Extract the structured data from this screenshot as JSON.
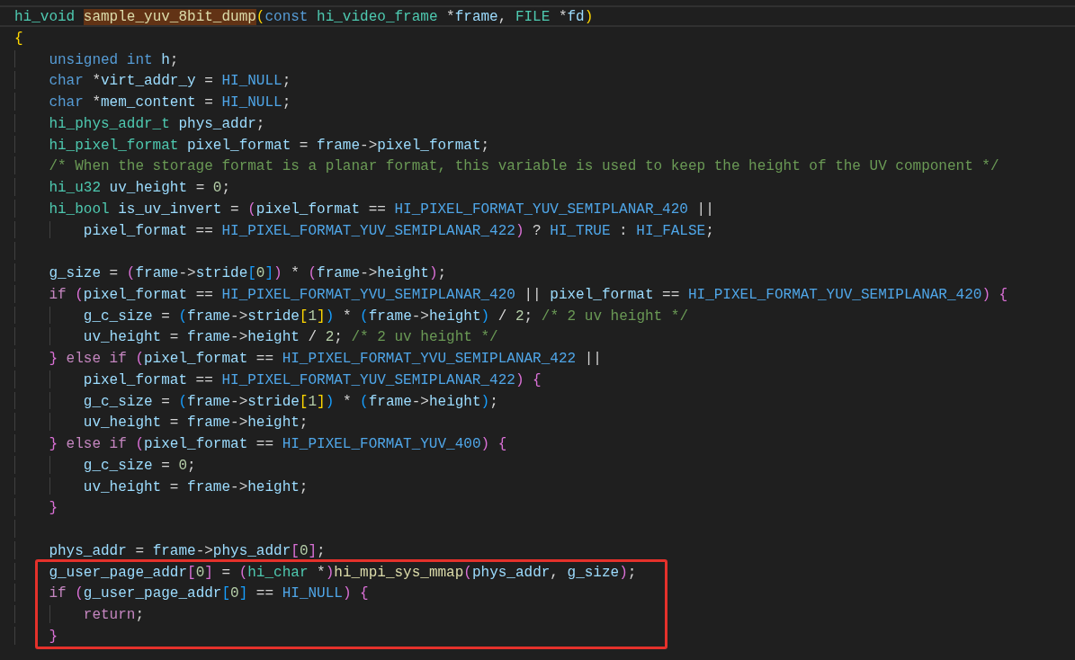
{
  "editor": {
    "lines": [
      {
        "kind": "code",
        "current": true,
        "boxed": false,
        "tokens": [
          {
            "kind": "type",
            "text": "hi_void "
          },
          {
            "kind": "fnmatch",
            "text": "sample_yuv_8bit_dump"
          },
          {
            "kind": "b1",
            "text": "("
          },
          {
            "kind": "kw",
            "text": "const "
          },
          {
            "kind": "type",
            "text": "hi_video_frame"
          },
          {
            "kind": "plain",
            "text": " *"
          },
          {
            "kind": "var",
            "text": "frame"
          },
          {
            "kind": "plain",
            "text": ", "
          },
          {
            "kind": "type",
            "text": "FILE"
          },
          {
            "kind": "plain",
            "text": " *"
          },
          {
            "kind": "var",
            "text": "fd"
          },
          {
            "kind": "b1",
            "text": ")"
          }
        ]
      },
      {
        "kind": "code",
        "current": false,
        "boxed": false,
        "tokens": [
          {
            "kind": "b1",
            "text": "{"
          }
        ]
      },
      {
        "kind": "code",
        "current": false,
        "boxed": false,
        "tokens": [
          {
            "kind": "kw",
            "text": "    unsigned int "
          },
          {
            "kind": "var",
            "text": "h"
          },
          {
            "kind": "plain",
            "text": ";"
          }
        ]
      },
      {
        "kind": "code",
        "current": false,
        "boxed": false,
        "tokens": [
          {
            "kind": "kw",
            "text": "    char"
          },
          {
            "kind": "plain",
            "text": " *"
          },
          {
            "kind": "var",
            "text": "virt_addr_y"
          },
          {
            "kind": "plain",
            "text": " = "
          },
          {
            "kind": "const",
            "text": "HI_NULL"
          },
          {
            "kind": "plain",
            "text": ";"
          }
        ]
      },
      {
        "kind": "code",
        "current": false,
        "boxed": false,
        "tokens": [
          {
            "kind": "kw",
            "text": "    char"
          },
          {
            "kind": "plain",
            "text": " *"
          },
          {
            "kind": "var",
            "text": "mem_content"
          },
          {
            "kind": "plain",
            "text": " = "
          },
          {
            "kind": "const",
            "text": "HI_NULL"
          },
          {
            "kind": "plain",
            "text": ";"
          }
        ]
      },
      {
        "kind": "code",
        "current": false,
        "boxed": false,
        "tokens": [
          {
            "kind": "type",
            "text": "    hi_phys_addr_t "
          },
          {
            "kind": "var",
            "text": "phys_addr"
          },
          {
            "kind": "plain",
            "text": ";"
          }
        ]
      },
      {
        "kind": "code",
        "current": false,
        "boxed": false,
        "tokens": [
          {
            "kind": "type",
            "text": "    hi_pixel_format "
          },
          {
            "kind": "var",
            "text": "pixel_format"
          },
          {
            "kind": "plain",
            "text": " = "
          },
          {
            "kind": "var",
            "text": "frame"
          },
          {
            "kind": "plain",
            "text": "->"
          },
          {
            "kind": "var",
            "text": "pixel_format"
          },
          {
            "kind": "plain",
            "text": ";"
          }
        ]
      },
      {
        "kind": "code",
        "current": false,
        "boxed": false,
        "tokens": [
          {
            "kind": "comment",
            "text": "    /* When the storage format is a planar format, this variable is used to keep the height of the UV component */"
          }
        ]
      },
      {
        "kind": "code",
        "current": false,
        "boxed": false,
        "tokens": [
          {
            "kind": "type",
            "text": "    hi_u32 "
          },
          {
            "kind": "var",
            "text": "uv_height"
          },
          {
            "kind": "plain",
            "text": " = "
          },
          {
            "kind": "num",
            "text": "0"
          },
          {
            "kind": "plain",
            "text": ";"
          }
        ]
      },
      {
        "kind": "code",
        "current": false,
        "boxed": false,
        "tokens": [
          {
            "kind": "type",
            "text": "    hi_bool "
          },
          {
            "kind": "var",
            "text": "is_uv_invert"
          },
          {
            "kind": "plain",
            "text": " = "
          },
          {
            "kind": "b2",
            "text": "("
          },
          {
            "kind": "var",
            "text": "pixel_format"
          },
          {
            "kind": "plain",
            "text": " == "
          },
          {
            "kind": "const",
            "text": "HI_PIXEL_FORMAT_YUV_SEMIPLANAR_420"
          },
          {
            "kind": "plain",
            "text": " ||"
          }
        ]
      },
      {
        "kind": "code",
        "current": false,
        "boxed": false,
        "tokens": [
          {
            "kind": "var",
            "text": "        pixel_format"
          },
          {
            "kind": "plain",
            "text": " == "
          },
          {
            "kind": "const",
            "text": "HI_PIXEL_FORMAT_YUV_SEMIPLANAR_422"
          },
          {
            "kind": "b2",
            "text": ")"
          },
          {
            "kind": "plain",
            "text": " ? "
          },
          {
            "kind": "const",
            "text": "HI_TRUE"
          },
          {
            "kind": "plain",
            "text": " : "
          },
          {
            "kind": "const",
            "text": "HI_FALSE"
          },
          {
            "kind": "plain",
            "text": ";"
          }
        ]
      },
      {
        "kind": "blank",
        "current": false,
        "boxed": false
      },
      {
        "kind": "code",
        "current": false,
        "boxed": false,
        "tokens": [
          {
            "kind": "var",
            "text": "    g_size"
          },
          {
            "kind": "plain",
            "text": " = "
          },
          {
            "kind": "b2",
            "text": "("
          },
          {
            "kind": "var",
            "text": "frame"
          },
          {
            "kind": "plain",
            "text": "->"
          },
          {
            "kind": "var",
            "text": "stride"
          },
          {
            "kind": "b3",
            "text": "["
          },
          {
            "kind": "num",
            "text": "0"
          },
          {
            "kind": "b3",
            "text": "]"
          },
          {
            "kind": "b2",
            "text": ")"
          },
          {
            "kind": "plain",
            "text": " * "
          },
          {
            "kind": "b2",
            "text": "("
          },
          {
            "kind": "var",
            "text": "frame"
          },
          {
            "kind": "plain",
            "text": "->"
          },
          {
            "kind": "var",
            "text": "height"
          },
          {
            "kind": "b2",
            "text": ")"
          },
          {
            "kind": "plain",
            "text": ";"
          }
        ]
      },
      {
        "kind": "code",
        "current": false,
        "boxed": false,
        "tokens": [
          {
            "kind": "ctrl",
            "text": "    if "
          },
          {
            "kind": "b2",
            "text": "("
          },
          {
            "kind": "var",
            "text": "pixel_format"
          },
          {
            "kind": "plain",
            "text": " == "
          },
          {
            "kind": "const",
            "text": "HI_PIXEL_FORMAT_YVU_SEMIPLANAR_420"
          },
          {
            "kind": "plain",
            "text": " || "
          },
          {
            "kind": "var",
            "text": "pixel_format"
          },
          {
            "kind": "plain",
            "text": " == "
          },
          {
            "kind": "const",
            "text": "HI_PIXEL_FORMAT_YUV_SEMIPLANAR_420"
          },
          {
            "kind": "b2",
            "text": ") {"
          }
        ]
      },
      {
        "kind": "code",
        "current": false,
        "boxed": false,
        "tokens": [
          {
            "kind": "var",
            "text": "        g_c_size"
          },
          {
            "kind": "plain",
            "text": " = "
          },
          {
            "kind": "b3",
            "text": "("
          },
          {
            "kind": "var",
            "text": "frame"
          },
          {
            "kind": "plain",
            "text": "->"
          },
          {
            "kind": "var",
            "text": "stride"
          },
          {
            "kind": "b1",
            "text": "["
          },
          {
            "kind": "num",
            "text": "1"
          },
          {
            "kind": "b1",
            "text": "]"
          },
          {
            "kind": "b3",
            "text": ")"
          },
          {
            "kind": "plain",
            "text": " * "
          },
          {
            "kind": "b3",
            "text": "("
          },
          {
            "kind": "var",
            "text": "frame"
          },
          {
            "kind": "plain",
            "text": "->"
          },
          {
            "kind": "var",
            "text": "height"
          },
          {
            "kind": "b3",
            "text": ")"
          },
          {
            "kind": "plain",
            "text": " / "
          },
          {
            "kind": "num",
            "text": "2"
          },
          {
            "kind": "plain",
            "text": "; "
          },
          {
            "kind": "comment",
            "text": "/* 2 uv height */"
          }
        ]
      },
      {
        "kind": "code",
        "current": false,
        "boxed": false,
        "tokens": [
          {
            "kind": "var",
            "text": "        uv_height"
          },
          {
            "kind": "plain",
            "text": " = "
          },
          {
            "kind": "var",
            "text": "frame"
          },
          {
            "kind": "plain",
            "text": "->"
          },
          {
            "kind": "var",
            "text": "height"
          },
          {
            "kind": "plain",
            "text": " / "
          },
          {
            "kind": "num",
            "text": "2"
          },
          {
            "kind": "plain",
            "text": "; "
          },
          {
            "kind": "comment",
            "text": "/* 2 uv height */"
          }
        ]
      },
      {
        "kind": "code",
        "current": false,
        "boxed": false,
        "tokens": [
          {
            "kind": "b2",
            "text": "    } "
          },
          {
            "kind": "ctrl",
            "text": "else if "
          },
          {
            "kind": "b2",
            "text": "("
          },
          {
            "kind": "var",
            "text": "pixel_format"
          },
          {
            "kind": "plain",
            "text": " == "
          },
          {
            "kind": "const",
            "text": "HI_PIXEL_FORMAT_YVU_SEMIPLANAR_422"
          },
          {
            "kind": "plain",
            "text": " ||"
          }
        ]
      },
      {
        "kind": "code",
        "current": false,
        "boxed": false,
        "tokens": [
          {
            "kind": "var",
            "text": "        pixel_format"
          },
          {
            "kind": "plain",
            "text": " == "
          },
          {
            "kind": "const",
            "text": "HI_PIXEL_FORMAT_YUV_SEMIPLANAR_422"
          },
          {
            "kind": "b2",
            "text": ") {"
          }
        ]
      },
      {
        "kind": "code",
        "current": false,
        "boxed": false,
        "tokens": [
          {
            "kind": "var",
            "text": "        g_c_size"
          },
          {
            "kind": "plain",
            "text": " = "
          },
          {
            "kind": "b3",
            "text": "("
          },
          {
            "kind": "var",
            "text": "frame"
          },
          {
            "kind": "plain",
            "text": "->"
          },
          {
            "kind": "var",
            "text": "stride"
          },
          {
            "kind": "b1",
            "text": "["
          },
          {
            "kind": "num",
            "text": "1"
          },
          {
            "kind": "b1",
            "text": "]"
          },
          {
            "kind": "b3",
            "text": ")"
          },
          {
            "kind": "plain",
            "text": " * "
          },
          {
            "kind": "b3",
            "text": "("
          },
          {
            "kind": "var",
            "text": "frame"
          },
          {
            "kind": "plain",
            "text": "->"
          },
          {
            "kind": "var",
            "text": "height"
          },
          {
            "kind": "b3",
            "text": ")"
          },
          {
            "kind": "plain",
            "text": ";"
          }
        ]
      },
      {
        "kind": "code",
        "current": false,
        "boxed": false,
        "tokens": [
          {
            "kind": "var",
            "text": "        uv_height"
          },
          {
            "kind": "plain",
            "text": " = "
          },
          {
            "kind": "var",
            "text": "frame"
          },
          {
            "kind": "plain",
            "text": "->"
          },
          {
            "kind": "var",
            "text": "height"
          },
          {
            "kind": "plain",
            "text": ";"
          }
        ]
      },
      {
        "kind": "code",
        "current": false,
        "boxed": false,
        "tokens": [
          {
            "kind": "b2",
            "text": "    } "
          },
          {
            "kind": "ctrl",
            "text": "else if "
          },
          {
            "kind": "b2",
            "text": "("
          },
          {
            "kind": "var",
            "text": "pixel_format"
          },
          {
            "kind": "plain",
            "text": " == "
          },
          {
            "kind": "const",
            "text": "HI_PIXEL_FORMAT_YUV_400"
          },
          {
            "kind": "b2",
            "text": ") {"
          }
        ]
      },
      {
        "kind": "code",
        "current": false,
        "boxed": false,
        "tokens": [
          {
            "kind": "var",
            "text": "        g_c_size"
          },
          {
            "kind": "plain",
            "text": " = "
          },
          {
            "kind": "num",
            "text": "0"
          },
          {
            "kind": "plain",
            "text": ";"
          }
        ]
      },
      {
        "kind": "code",
        "current": false,
        "boxed": false,
        "tokens": [
          {
            "kind": "var",
            "text": "        uv_height"
          },
          {
            "kind": "plain",
            "text": " = "
          },
          {
            "kind": "var",
            "text": "frame"
          },
          {
            "kind": "plain",
            "text": "->"
          },
          {
            "kind": "var",
            "text": "height"
          },
          {
            "kind": "plain",
            "text": ";"
          }
        ]
      },
      {
        "kind": "code",
        "current": false,
        "boxed": false,
        "tokens": [
          {
            "kind": "b2",
            "text": "    }"
          }
        ]
      },
      {
        "kind": "blank",
        "current": false,
        "boxed": false
      },
      {
        "kind": "code",
        "current": false,
        "boxed": false,
        "tokens": [
          {
            "kind": "var",
            "text": "    phys_addr"
          },
          {
            "kind": "plain",
            "text": " = "
          },
          {
            "kind": "var",
            "text": "frame"
          },
          {
            "kind": "plain",
            "text": "->"
          },
          {
            "kind": "var",
            "text": "phys_addr"
          },
          {
            "kind": "b2",
            "text": "["
          },
          {
            "kind": "num",
            "text": "0"
          },
          {
            "kind": "b2",
            "text": "]"
          },
          {
            "kind": "plain",
            "text": ";"
          }
        ]
      },
      {
        "kind": "code",
        "current": false,
        "boxed": true,
        "tokens": [
          {
            "kind": "var",
            "text": "    g_user_page_addr"
          },
          {
            "kind": "b2",
            "text": "["
          },
          {
            "kind": "num",
            "text": "0"
          },
          {
            "kind": "b2",
            "text": "]"
          },
          {
            "kind": "plain",
            "text": " = "
          },
          {
            "kind": "b2",
            "text": "("
          },
          {
            "kind": "type",
            "text": "hi_char"
          },
          {
            "kind": "plain",
            "text": " *"
          },
          {
            "kind": "b2",
            "text": ")"
          },
          {
            "kind": "fn",
            "text": "hi_mpi_sys_mmap"
          },
          {
            "kind": "b2",
            "text": "("
          },
          {
            "kind": "var",
            "text": "phys_addr"
          },
          {
            "kind": "plain",
            "text": ", "
          },
          {
            "kind": "var",
            "text": "g_size"
          },
          {
            "kind": "b2",
            "text": ")"
          },
          {
            "kind": "plain",
            "text": ";"
          }
        ]
      },
      {
        "kind": "code",
        "current": false,
        "boxed": true,
        "tokens": [
          {
            "kind": "ctrl",
            "text": "    if "
          },
          {
            "kind": "b2",
            "text": "("
          },
          {
            "kind": "var",
            "text": "g_user_page_addr"
          },
          {
            "kind": "b3",
            "text": "["
          },
          {
            "kind": "num",
            "text": "0"
          },
          {
            "kind": "b3",
            "text": "]"
          },
          {
            "kind": "plain",
            "text": " == "
          },
          {
            "kind": "const",
            "text": "HI_NULL"
          },
          {
            "kind": "b2",
            "text": ") {"
          }
        ]
      },
      {
        "kind": "code",
        "current": false,
        "boxed": true,
        "tokens": [
          {
            "kind": "ctrl",
            "text": "        return"
          },
          {
            "kind": "plain",
            "text": ";"
          }
        ]
      },
      {
        "kind": "code",
        "current": false,
        "boxed": true,
        "tokens": [
          {
            "kind": "b2",
            "text": "    }"
          }
        ]
      }
    ]
  }
}
